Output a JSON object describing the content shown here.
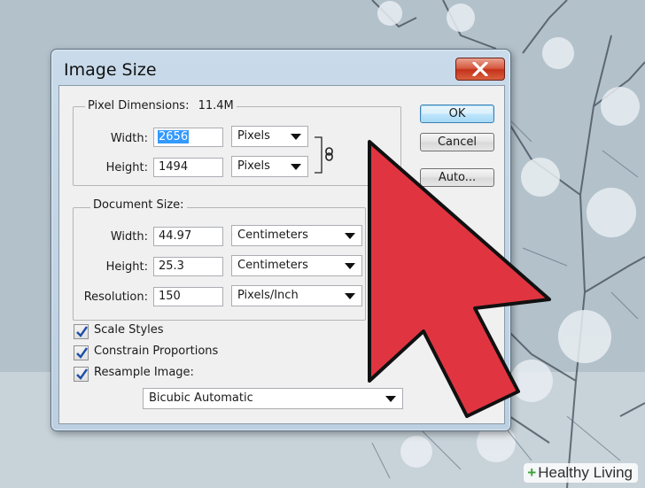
{
  "dialog": {
    "title": "Image Size",
    "close_icon": "close-x-icon"
  },
  "pixel_dimensions": {
    "label": "Pixel Dimensions:",
    "size": "11.4M",
    "width_label": "Width:",
    "width_value": "2656",
    "width_unit": "Pixels",
    "height_label": "Height:",
    "height_value": "1494",
    "height_unit": "Pixels",
    "link_icon": "chain-link-icon"
  },
  "document_size": {
    "label": "Document Size:",
    "width_label": "Width:",
    "width_value": "44.97",
    "width_unit": "Centimeters",
    "height_label": "Height:",
    "height_value": "25.3",
    "height_unit": "Centimeters",
    "resolution_label": "Resolution:",
    "resolution_value": "150",
    "resolution_unit": "Pixels/Inch"
  },
  "options": {
    "scale_styles": {
      "label": "Scale Styles",
      "checked": true
    },
    "constrain_proportions": {
      "label": "Constrain Proportions",
      "checked": true
    },
    "resample_image": {
      "label": "Resample Image:",
      "checked": true
    },
    "resample_method": "Bicubic Automatic"
  },
  "buttons": {
    "ok": "OK",
    "cancel": "Cancel",
    "auto": "Auto..."
  },
  "overlay": {
    "arrow_color": "#e03540",
    "arrow_icon": "red-pointer-arrow"
  },
  "watermark": {
    "plus": "+",
    "text": "Healthy Living"
  }
}
